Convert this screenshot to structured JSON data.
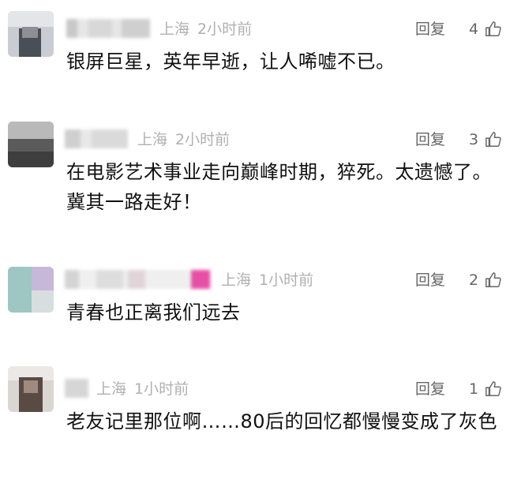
{
  "comments": [
    {
      "location": "上海",
      "time": "2小时前",
      "reply_label": "回复",
      "likes": "4",
      "text": "银屏巨星，英年早逝，让人唏嘘不已。"
    },
    {
      "location": "上海",
      "time": "2小时前",
      "reply_label": "回复",
      "likes": "3",
      "text": "在电影艺术事业走向巅峰时期，猝死。太遗憾了。冀其一路走好！"
    },
    {
      "location": "上海",
      "time": "1小时前",
      "reply_label": "回复",
      "likes": "2",
      "text": "青春也正离我们远去"
    },
    {
      "location": "上海",
      "time": "1小时前",
      "reply_label": "回复",
      "likes": "1",
      "text": "老友记里那位啊……80后的回忆都慢慢变成了灰色"
    }
  ],
  "colors": {
    "meta_gray": "#b0b0b0",
    "action_gray": "#666666",
    "text_black": "#111111"
  },
  "icons": [
    "thumbs-up-icon"
  ]
}
